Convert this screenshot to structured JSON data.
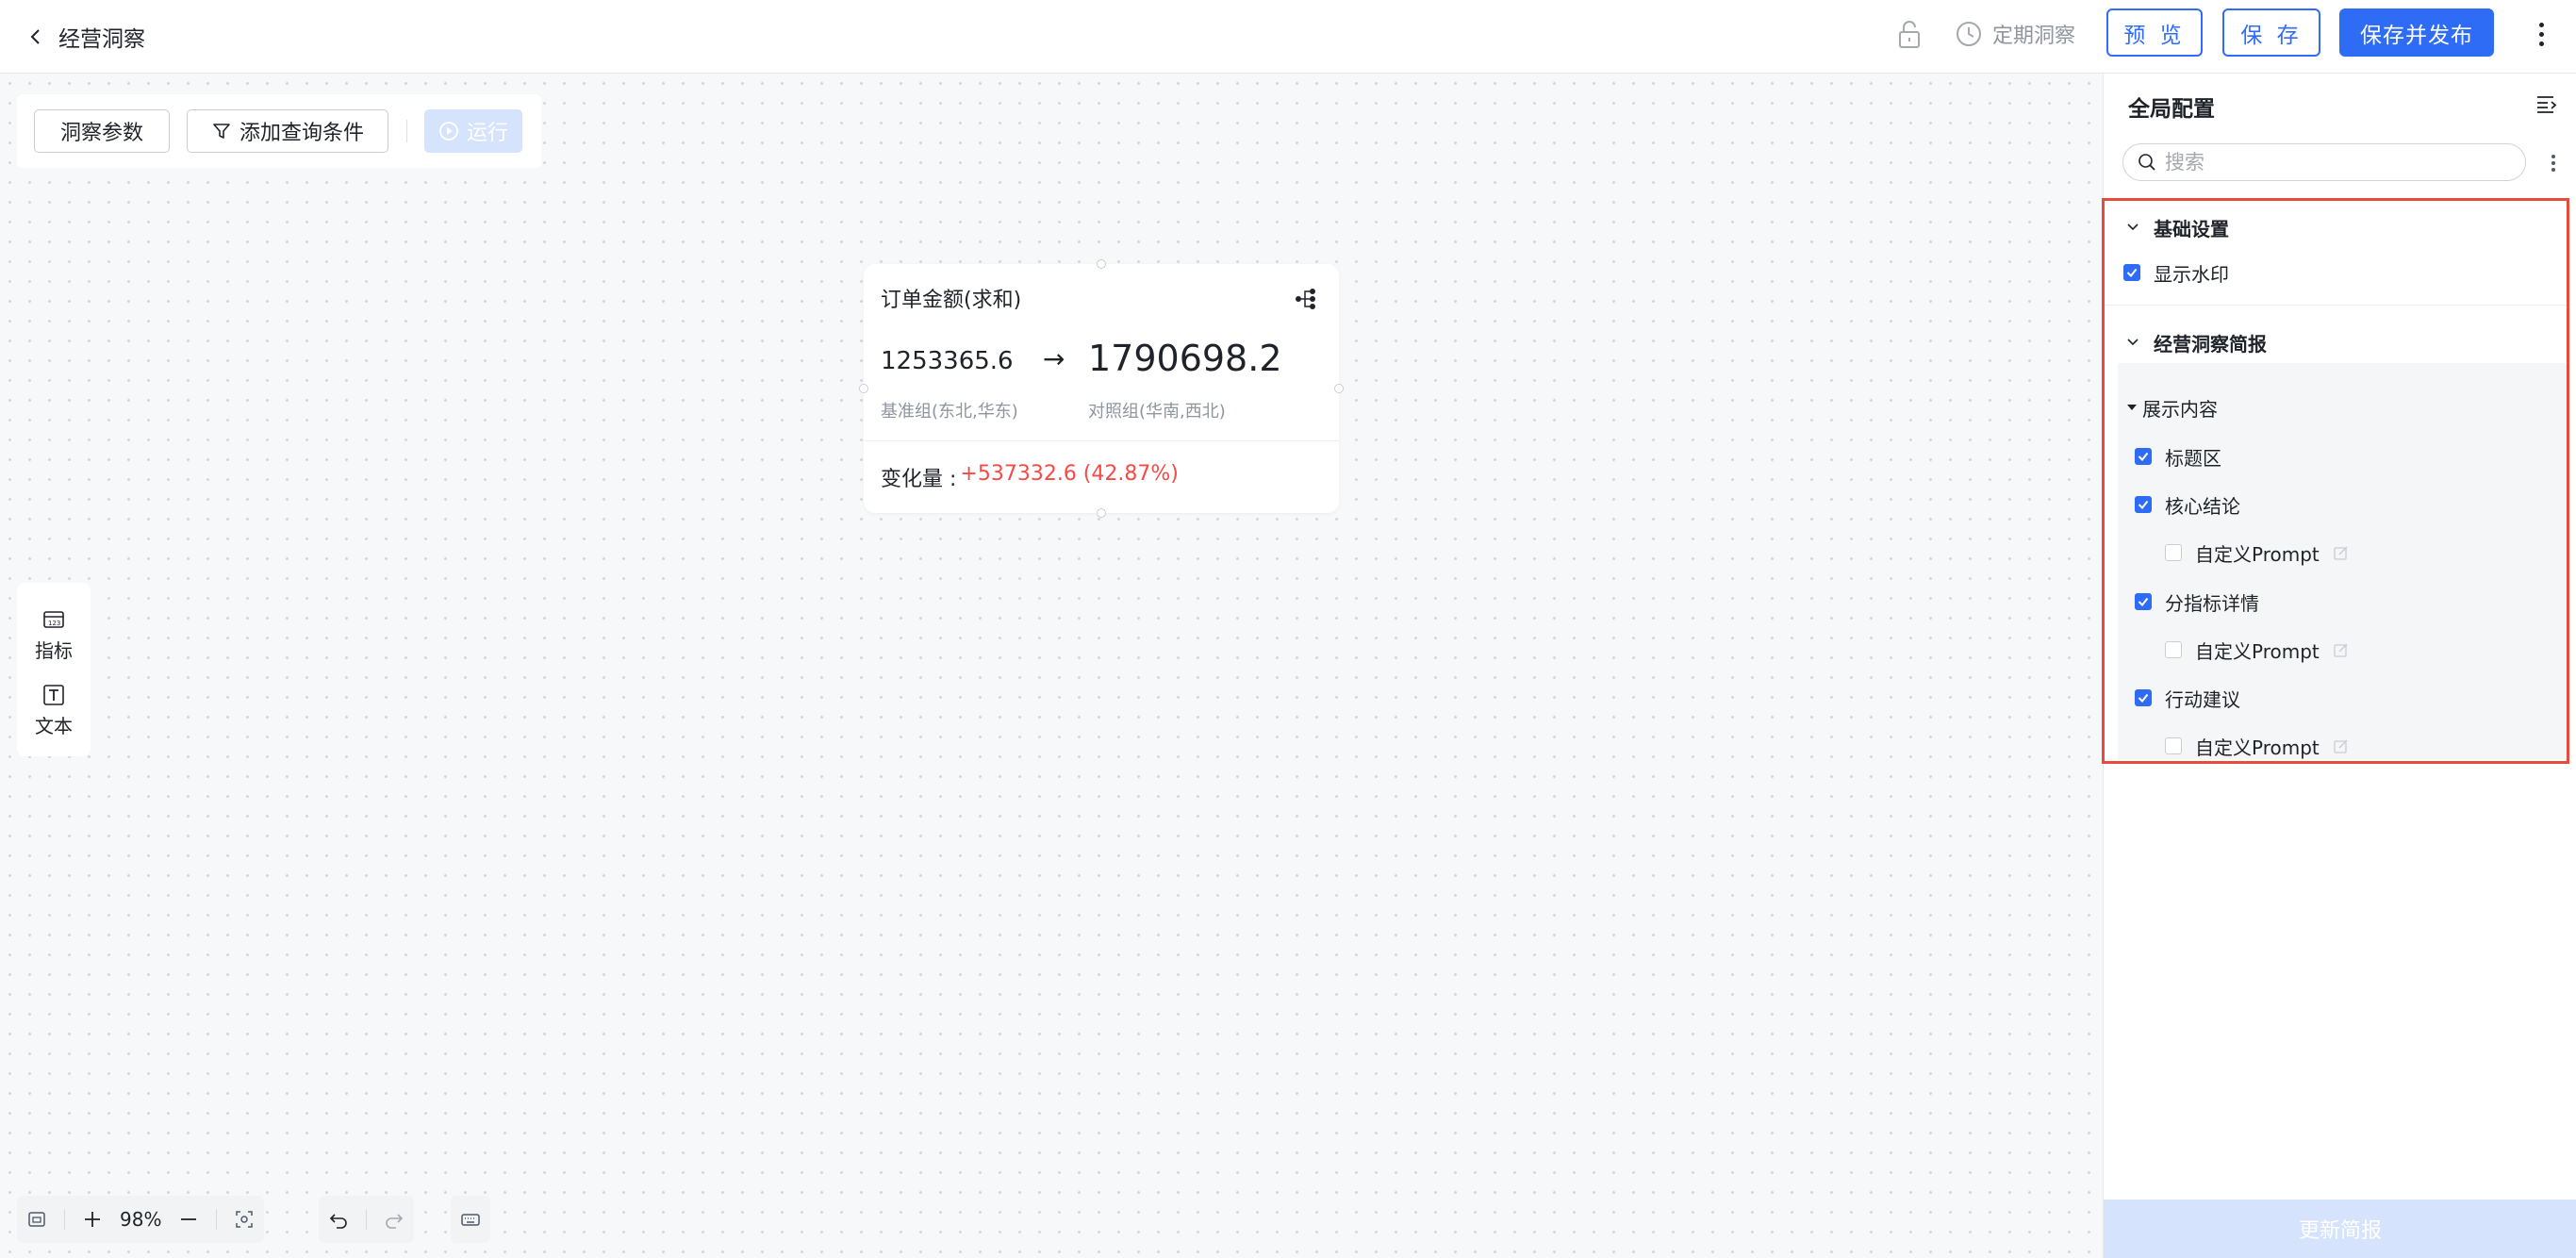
{
  "header": {
    "title": "经营洞察",
    "schedule_label": "定期洞察",
    "preview_label": "预 览",
    "save_label": "保 存",
    "save_publish_label": "保存并发布"
  },
  "toolbar": {
    "params_label": "洞察参数",
    "add_filter_label": "添加查询条件",
    "run_label": "运行"
  },
  "card": {
    "title": "订单金额(求和)",
    "base_value": "1253365.6",
    "arrow": "→",
    "compare_value": "1790698.2",
    "base_label": "基准组(东北,华东)",
    "compare_label": "对照组(华南,西北)",
    "change_label": "变化量 :",
    "change_value": "+537332.6 (42.87%)",
    "change_color": "#f54a45"
  },
  "palette": {
    "metric_label": "指标",
    "text_label": "文本"
  },
  "bottom_bar": {
    "zoom": "98%"
  },
  "panel": {
    "title": "全局配置",
    "search_placeholder": "搜索",
    "sections": {
      "basic": {
        "title": "基础设置",
        "watermark": {
          "label": "显示水印",
          "checked": true
        }
      },
      "brief": {
        "title": "经营洞察简报",
        "content_title": "展示内容",
        "items": [
          {
            "label": "标题区",
            "checked": true
          },
          {
            "label": "核心结论",
            "checked": true
          },
          {
            "label": "自定义Prompt",
            "checked": false
          },
          {
            "label": "分指标详情",
            "checked": true
          },
          {
            "label": "自定义Prompt",
            "checked": false
          },
          {
            "label": "行动建议",
            "checked": true
          },
          {
            "label": "自定义Prompt",
            "checked": false
          }
        ]
      }
    },
    "update_label": "更新简报"
  },
  "colors": {
    "primary": "#2e6cf6",
    "highlight_border": "#e84b3c",
    "delta_red": "#f54a45"
  }
}
